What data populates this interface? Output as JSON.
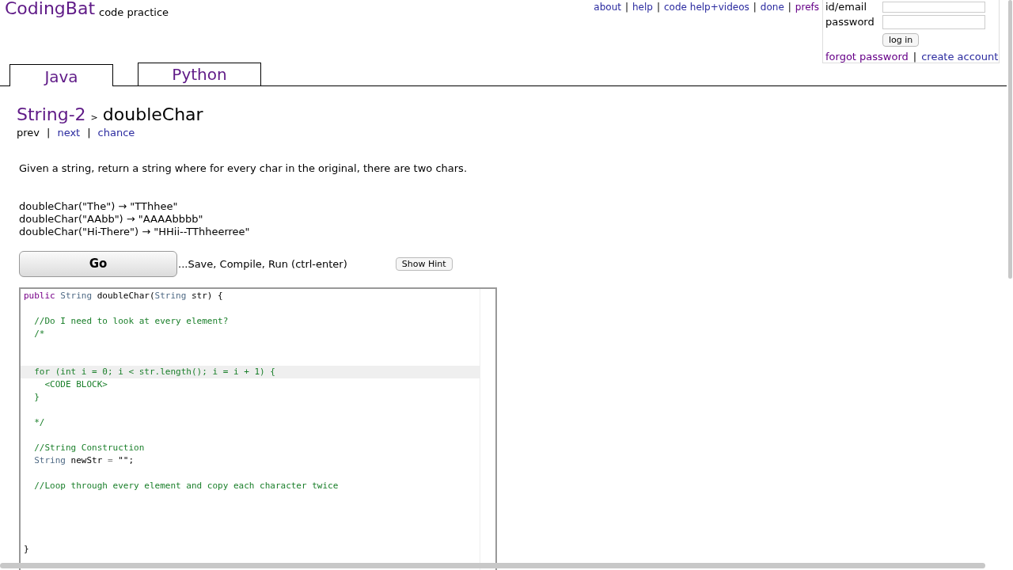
{
  "header": {
    "logo": "CodingBat",
    "tagline": "code practice",
    "links": [
      {
        "label": "about",
        "kind": "link"
      },
      {
        "label": "|",
        "kind": "sep"
      },
      {
        "label": "help",
        "kind": "link"
      },
      {
        "label": "|",
        "kind": "sep"
      },
      {
        "label": "code help+videos",
        "kind": "link"
      },
      {
        "label": "|",
        "kind": "sep"
      },
      {
        "label": "done",
        "kind": "link"
      },
      {
        "label": "|",
        "kind": "sep"
      },
      {
        "label": "prefs",
        "kind": "visited"
      }
    ]
  },
  "login": {
    "id_label": "id/email",
    "password_label": "password",
    "button": "log in",
    "forgot": "forgot password",
    "separator": "|",
    "create": "create account"
  },
  "tabs": [
    {
      "label": "Java",
      "selected": true
    },
    {
      "label": "Python",
      "selected": false
    }
  ],
  "problem": {
    "section": "String-2",
    "crumb_sep": ">",
    "name": "doubleChar",
    "nav": [
      {
        "label": "prev",
        "kind": "plain"
      },
      {
        "label": "|",
        "kind": "sep"
      },
      {
        "label": "next",
        "kind": "link"
      },
      {
        "label": "|",
        "kind": "sep"
      },
      {
        "label": "chance",
        "kind": "link"
      }
    ],
    "description": "Given a string, return a string where for every char in the original, there are two chars.",
    "examples": [
      "doubleChar(\"The\") → \"TThhee\"",
      "doubleChar(\"AAbb\") → \"AAAAbbbb\"",
      "doubleChar(\"Hi-There\") → \"HHii--TThheerree\""
    ]
  },
  "actions": {
    "go": "Go",
    "go_note": "...Save, Compile, Run (ctrl-enter)",
    "hint": "Show Hint"
  },
  "editor": {
    "lines": [
      {
        "active": false,
        "tokens": [
          {
            "kind": "keyword",
            "text": "public"
          },
          {
            "kind": "type",
            "text": " String"
          },
          {
            "kind": "plain",
            "text": " doubleChar("
          },
          {
            "kind": "type",
            "text": "String"
          },
          {
            "kind": "plain",
            "text": " str) {"
          }
        ]
      },
      {
        "active": false
      },
      {
        "active": false,
        "tokens": [
          {
            "kind": "comment",
            "text": "  //Do I need to look at every element?"
          }
        ]
      },
      {
        "active": false,
        "tokens": [
          {
            "kind": "comment",
            "text": "  /*"
          }
        ]
      },
      {
        "active": false
      },
      {
        "active": false
      },
      {
        "active": true,
        "tokens": [
          {
            "kind": "comment",
            "text": "  for (int i = 0; i < str.length(); i = i + 1) {"
          }
        ]
      },
      {
        "active": false,
        "tokens": [
          {
            "kind": "comment",
            "text": "    <CODE BLOCK>"
          }
        ]
      },
      {
        "active": false,
        "tokens": [
          {
            "kind": "comment",
            "text": "  }"
          }
        ]
      },
      {
        "active": false
      },
      {
        "active": false,
        "tokens": [
          {
            "kind": "comment",
            "text": "  */"
          }
        ]
      },
      {
        "active": false
      },
      {
        "active": false,
        "tokens": [
          {
            "kind": "comment",
            "text": "  //String Construction"
          }
        ]
      },
      {
        "active": false,
        "tokens": [
          {
            "kind": "type",
            "text": "  String"
          },
          {
            "kind": "plain",
            "text": " newStr "
          },
          {
            "kind": "operator",
            "text": "="
          },
          {
            "kind": "plain",
            "text": " \"\";"
          }
        ]
      },
      {
        "active": false
      },
      {
        "active": false,
        "tokens": [
          {
            "kind": "comment",
            "text": "  //Loop through every element and copy each character twice"
          }
        ]
      },
      {
        "active": false
      },
      {
        "active": false
      },
      {
        "active": false
      },
      {
        "active": false
      },
      {
        "active": false,
        "tokens": [
          {
            "kind": "plain",
            "text": "}"
          }
        ]
      }
    ]
  }
}
